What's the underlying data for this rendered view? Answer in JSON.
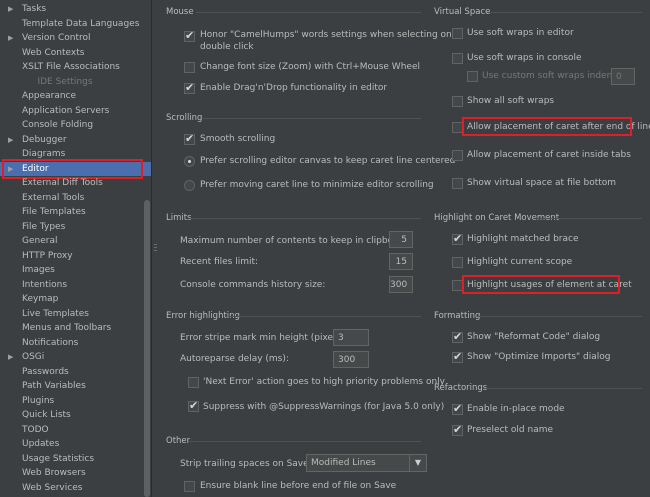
{
  "sidebar": {
    "items": [
      {
        "label": "Tasks",
        "arrow": "▶"
      },
      {
        "label": "Template Data Languages"
      },
      {
        "label": "Version Control",
        "arrow": "▶"
      },
      {
        "label": "Web Contexts"
      },
      {
        "label": "XSLT File Associations"
      },
      {
        "label": "IDE Settings",
        "category": true
      },
      {
        "label": "Appearance"
      },
      {
        "label": "Application Servers"
      },
      {
        "label": "Console Folding"
      },
      {
        "label": "Debugger",
        "arrow": "▶"
      },
      {
        "label": "Diagrams"
      },
      {
        "label": "Editor",
        "arrow": "▶",
        "selected": true
      },
      {
        "label": "External Diff Tools"
      },
      {
        "label": "External Tools"
      },
      {
        "label": "File Templates"
      },
      {
        "label": "File Types"
      },
      {
        "label": "General"
      },
      {
        "label": "HTTP Proxy"
      },
      {
        "label": "Images"
      },
      {
        "label": "Intentions"
      },
      {
        "label": "Keymap"
      },
      {
        "label": "Live Templates"
      },
      {
        "label": "Menus and Toolbars"
      },
      {
        "label": "Notifications"
      },
      {
        "label": "OSGi",
        "arrow": "▶"
      },
      {
        "label": "Passwords"
      },
      {
        "label": "Path Variables"
      },
      {
        "label": "Plugins"
      },
      {
        "label": "Quick Lists"
      },
      {
        "label": "TODO"
      },
      {
        "label": "Updates"
      },
      {
        "label": "Usage Statistics"
      },
      {
        "label": "Web Browsers"
      },
      {
        "label": "Web Services"
      }
    ]
  },
  "mouse": {
    "title": "Mouse",
    "camel_1": "Honor \"CamelHumps\" words settings when selecting on",
    "camel_2": "double click",
    "zoom": "Change font size (Zoom) with Ctrl+Mouse Wheel",
    "dnd": "Enable Drag'n'Drop functionality in editor"
  },
  "scrolling": {
    "title": "Scrolling",
    "smooth": "Smooth scrolling",
    "prefer_canvas": "Prefer scrolling editor canvas to keep caret line centered",
    "prefer_caret": "Prefer moving caret line to minimize editor scrolling"
  },
  "limits": {
    "title": "Limits",
    "clipboard_label": "Maximum number of contents to keep in clipboard:",
    "clipboard_value": "5",
    "recent_label": "Recent files limit:",
    "recent_value": "15",
    "console_label": "Console commands history size:",
    "console_value": "300"
  },
  "error": {
    "title": "Error highlighting",
    "stripe_label": "Error stripe mark min height (pixels):",
    "stripe_value": "3",
    "reparse_label": "Autoreparse delay (ms):",
    "reparse_value": "300",
    "next_error": "'Next Error' action goes to high priority problems only",
    "suppress": "Suppress with @SuppressWarnings (for Java 5.0 only)"
  },
  "other": {
    "title": "Other",
    "strip_label": "Strip trailing spaces on Save:",
    "strip_value": "Modified Lines",
    "blank_line": "Ensure blank line before end of file on Save"
  },
  "virtual": {
    "title": "Virtual Space",
    "soft_editor": "Use soft wraps in editor",
    "soft_console": "Use soft wraps in console",
    "custom_indent": "Use custom soft wraps indent",
    "custom_indent_value": "0",
    "show_all": "Show all soft wraps",
    "after_eol": "Allow placement of caret after end of line",
    "inside_tabs": "Allow placement of caret inside tabs",
    "show_virtual": "Show virtual space at file bottom"
  },
  "caret": {
    "title": "Highlight on Caret Movement",
    "brace": "Highlight matched brace",
    "scope": "Highlight current scope",
    "usages": "Highlight usages of element at caret"
  },
  "formatting": {
    "title": "Formatting",
    "reformat": "Show \"Reformat Code\" dialog",
    "optimize": "Show \"Optimize Imports\" dialog"
  },
  "refactorings": {
    "title": "Refactorings",
    "inplace": "Enable in-place mode",
    "preselect": "Preselect old name"
  },
  "colors": {
    "background": "#3c3f41",
    "selection": "#4b6eaf",
    "highlight_box": "#dd1f2a"
  }
}
